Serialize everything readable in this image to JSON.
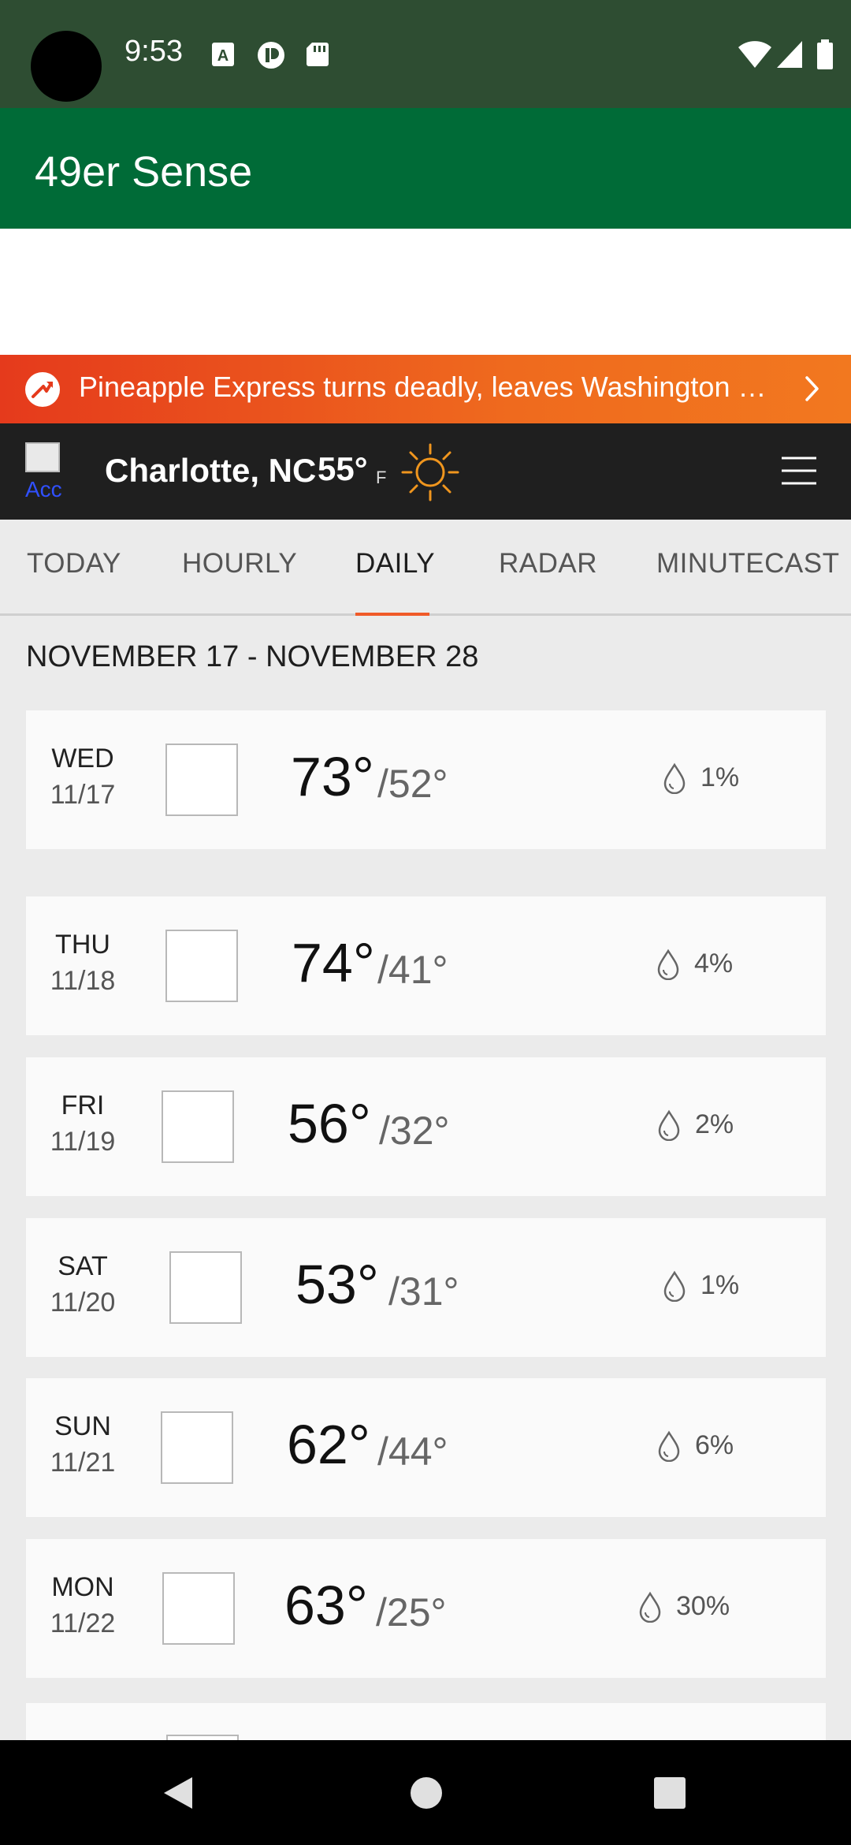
{
  "status_bar": {
    "time": "9:53"
  },
  "app_bar": {
    "title": "49er Sense"
  },
  "alert": {
    "text": "Pineapple Express turns deadly, leaves Washington s..."
  },
  "location": {
    "city": "Charlotte, NC",
    "temp": "55°",
    "unit": "F",
    "broken_image_alt": "Acc"
  },
  "tabs": [
    {
      "label": "TODAY"
    },
    {
      "label": "HOURLY"
    },
    {
      "label": "DAILY"
    },
    {
      "label": "RADAR"
    },
    {
      "label": "MINUTECAST"
    }
  ],
  "active_tab": "DAILY",
  "date_range": "NOVEMBER 17 - NOVEMBER 28",
  "days": [
    {
      "day": "WED",
      "date": "11/17",
      "hi": "73°",
      "lo": "/52°",
      "precip": "1%"
    },
    {
      "day": "THU",
      "date": "11/18",
      "hi": "74°",
      "lo": "/41°",
      "precip": "4%"
    },
    {
      "day": "FRI",
      "date": "11/19",
      "hi": "56°",
      "lo": "/32°",
      "precip": "2%"
    },
    {
      "day": "SAT",
      "date": "11/20",
      "hi": "53°",
      "lo": "/31°",
      "precip": "1%"
    },
    {
      "day": "SUN",
      "date": "11/21",
      "hi": "62°",
      "lo": "/44°",
      "precip": "6%"
    },
    {
      "day": "MON",
      "date": "11/22",
      "hi": "63°",
      "lo": "/25°",
      "precip": "30%"
    }
  ],
  "colors": {
    "status_bar": "#2e4d32",
    "app_bar": "#006b37",
    "alert_start": "#e53a1c",
    "alert_end": "#f2781f",
    "location_bar": "#1f1f1f",
    "tab_accent": "#f05a28",
    "sun": "#f0961e"
  },
  "icons": {
    "status_left": [
      "text-format-icon",
      "vpn-icon",
      "sd-card-icon"
    ],
    "status_right": [
      "wifi-icon",
      "signal-icon",
      "battery-icon"
    ],
    "alert": "trending-arrow-icon",
    "current_weather": "sun-icon",
    "menu": "hamburger-menu-icon",
    "precip": "raindrop-icon",
    "nav": [
      "back-icon",
      "home-icon",
      "recents-icon"
    ]
  }
}
